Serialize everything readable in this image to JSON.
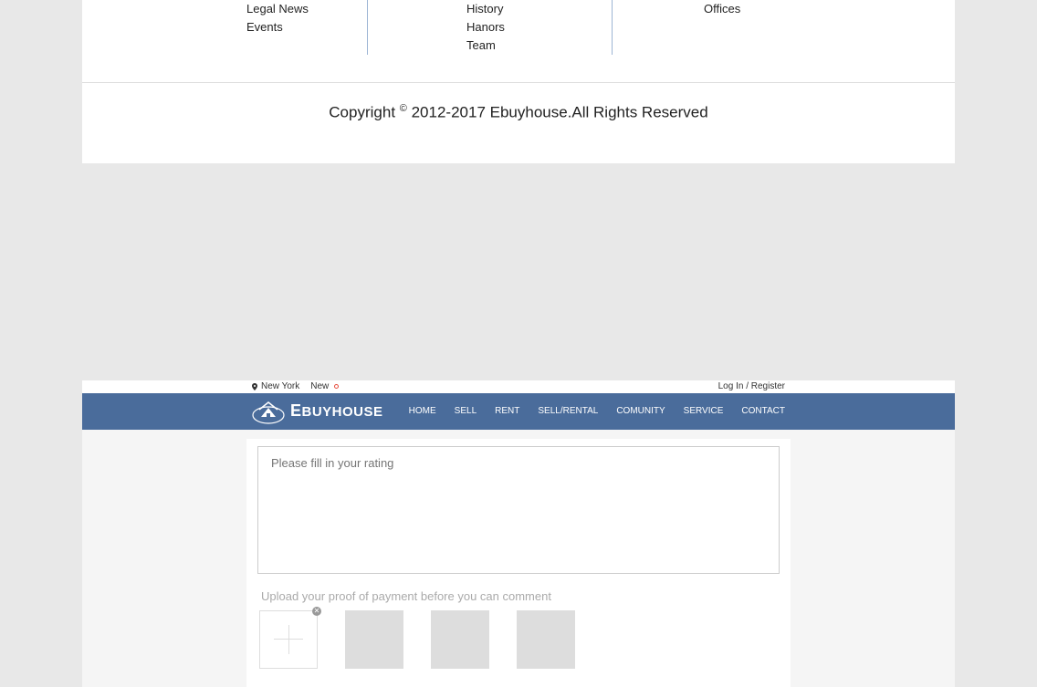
{
  "footer": {
    "col1": [
      "Legal News",
      "Events"
    ],
    "col2": [
      "History",
      "Hanors",
      "Team"
    ],
    "col3": [
      "Offices"
    ]
  },
  "copyright": {
    "prefix": "Copyright ",
    "symbol": "©",
    "suffix": " 2012-2017 Ebuyhouse.All Rights Reserved"
  },
  "topbar": {
    "location": "New York",
    "new_label": "New",
    "login": "Log In / Register"
  },
  "logo": {
    "text_e": "E",
    "text_rest": "BUYHOUSE"
  },
  "nav": {
    "home": "HOME",
    "sell": "SELL",
    "rent": "RENT",
    "sell_rental": "SELL/RENTAL",
    "comunity": "COMUNITY",
    "service": "SERVICE",
    "contact": "CONTACT"
  },
  "comment": {
    "placeholder": "Please fill in your rating",
    "upload_label": "Upload your proof of payment before you can comment"
  }
}
